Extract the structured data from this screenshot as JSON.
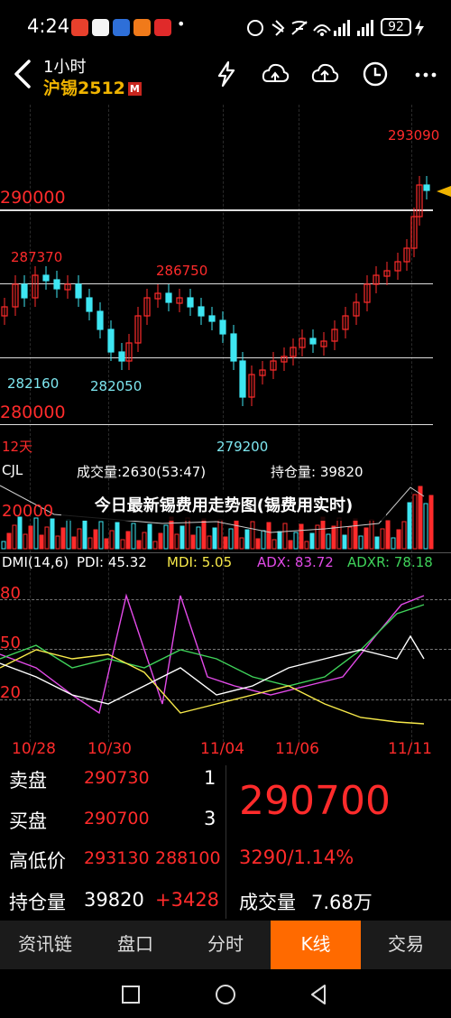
{
  "status_bar": {
    "time": "4:24",
    "app_icons": [
      "app-icon-red",
      "app-icon-blue",
      "app-icon-blue2",
      "app-icon-orange",
      "app-icon-red2",
      "more-dots"
    ],
    "battery": "92"
  },
  "header": {
    "period": "1小时",
    "symbol": "沪锡2512",
    "badge": "M"
  },
  "chart": {
    "price_labels": {
      "high": "293090",
      "level_290000": "290000",
      "p287370": "287370",
      "p286750": "286750",
      "p282160": "282160",
      "p282050": "282050",
      "level_280000": "280000",
      "low": "279200",
      "period_count": "12天"
    },
    "volume": {
      "name": "CJL",
      "vol_label": "成交量:2630(53:47)",
      "oi_label": "持仓量: 39820",
      "axis": "20000"
    },
    "dmi": {
      "name": "DMI(14,6)",
      "pdi": "PDI: 45.32",
      "mdi": "MDI: 5.05",
      "adx": "ADX: 83.72",
      "adxr": "ADXR: 78.18",
      "axis": [
        "80",
        "50",
        "20"
      ]
    },
    "dates": [
      "10/28",
      "10/30",
      "11/04",
      "11/06",
      "11/11"
    ],
    "banner": "今日最新锡费用走势图(锡费用实时)"
  },
  "panel": {
    "sell_label": "卖盘",
    "sell_price": "290730",
    "sell_qty": "1",
    "buy_label": "买盘",
    "buy_price": "290700",
    "buy_qty": "3",
    "hl_label": "高低价",
    "high": "293130",
    "low": "288100",
    "oi_label": "持仓量",
    "oi": "39820",
    "oi_change": "+3428",
    "last_price": "290700",
    "change": "3290/1.14%",
    "vol_label": "成交量",
    "vol": "7.68万"
  },
  "tabs": [
    "资讯链",
    "盘口",
    "分时",
    "K线",
    "交易"
  ],
  "colors": {
    "up": "#ff2b2b",
    "down": "#3ee6f2",
    "accent": "#ff6a00",
    "symbol": "#f0b400"
  }
}
